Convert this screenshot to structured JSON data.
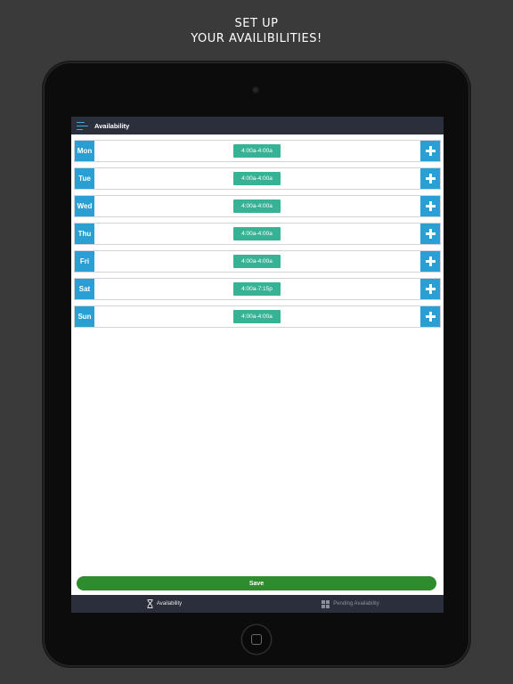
{
  "headline": {
    "line1": "SET UP",
    "line2": "YOUR AVAILIBILITIES!"
  },
  "app": {
    "title": "Availability",
    "accent_color": "#2a9fd4",
    "slot_color": "#37b294",
    "save_color": "#2e8b2e"
  },
  "days": [
    {
      "label": "Mon",
      "slot": "4:00a-4:00a"
    },
    {
      "label": "Tue",
      "slot": "4:00a-4:00a"
    },
    {
      "label": "Wed",
      "slot": "4:00a-4:00a"
    },
    {
      "label": "Thu",
      "slot": "4:00a-4:00a"
    },
    {
      "label": "Fri",
      "slot": "4:00a-4:00a"
    },
    {
      "label": "Sat",
      "slot": "4:00a-7:15p"
    },
    {
      "label": "Sun",
      "slot": "4:00a-4:00a"
    }
  ],
  "save_label": "Save",
  "tabs": [
    {
      "label": "Availability",
      "icon": "hourglass-icon",
      "active": true
    },
    {
      "label": "Pending Availability",
      "icon": "grid-icon",
      "active": false
    }
  ]
}
